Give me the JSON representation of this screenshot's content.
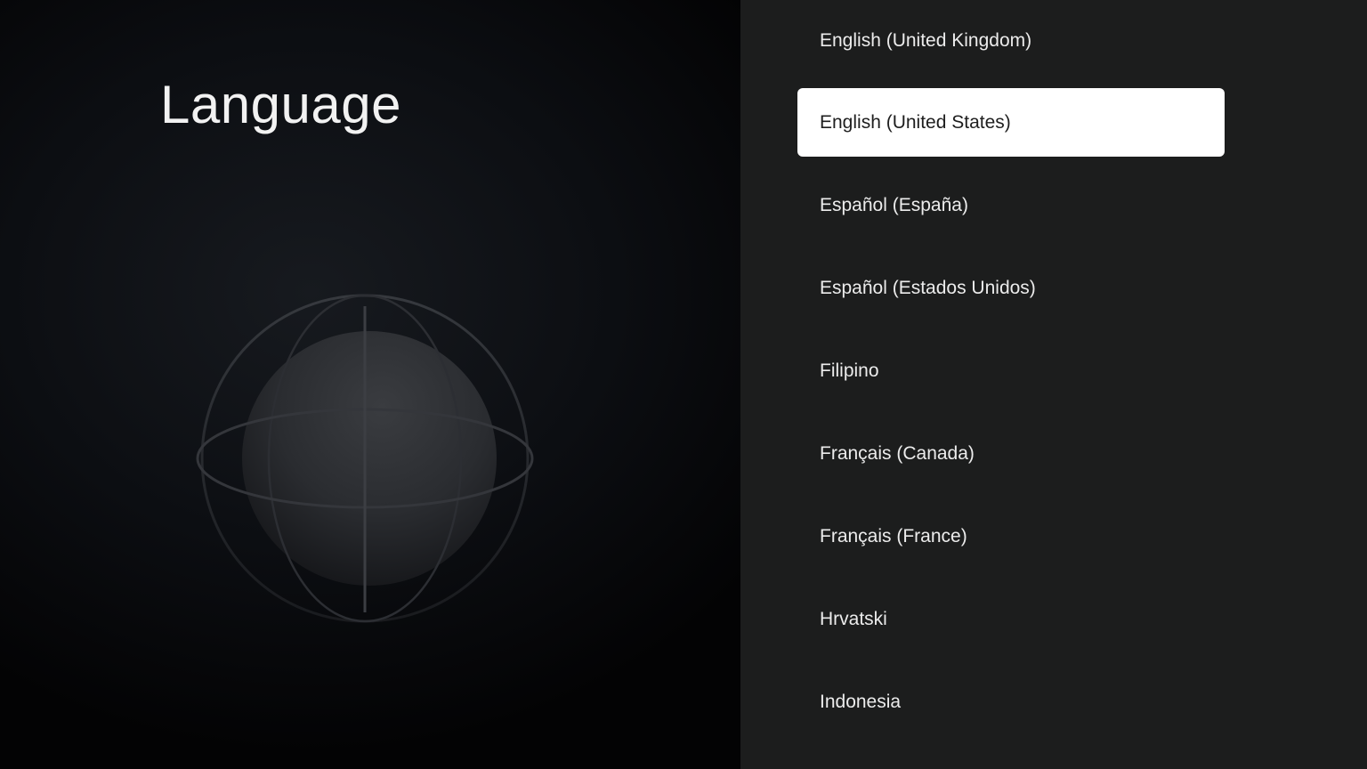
{
  "header": {
    "title": "Language"
  },
  "languages": {
    "selected_index": 1,
    "items": [
      {
        "label": "English (United Kingdom)"
      },
      {
        "label": "English (United States)"
      },
      {
        "label": "Español (España)"
      },
      {
        "label": "Español (Estados Unidos)"
      },
      {
        "label": "Filipino"
      },
      {
        "label": "Français (Canada)"
      },
      {
        "label": "Français (France)"
      },
      {
        "label": "Hrvatski"
      },
      {
        "label": "Indonesia"
      }
    ]
  },
  "colors": {
    "left_background": "#0c0e12",
    "right_background": "#1c1d1d",
    "selected_item_background": "#ffffff",
    "selected_item_text": "#1e1e1e",
    "item_text": "#ececec"
  },
  "icons": {
    "illustration": "globe-icon"
  }
}
